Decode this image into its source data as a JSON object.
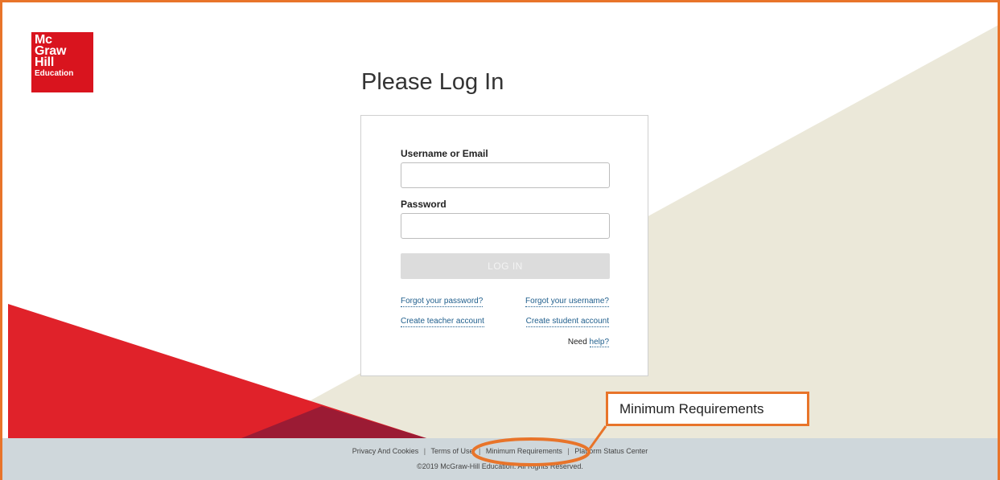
{
  "logo": {
    "line1": "Mc",
    "line2": "Graw",
    "line3": "Hill",
    "line4": "Education"
  },
  "page": {
    "title": "Please Log In"
  },
  "form": {
    "username_label": "Username or Email",
    "username_value": "",
    "password_label": "Password",
    "password_value": "",
    "login_label": "LOG IN",
    "forgot_password": "Forgot your password?",
    "forgot_username": "Forgot your username?",
    "create_teacher": "Create teacher account",
    "create_student": "Create student account",
    "need_text": "Need",
    "help_link": "help?"
  },
  "footer": {
    "links": [
      "Privacy And Cookies",
      "Terms of Use",
      "Minimum Requirements",
      "Platform Status Center"
    ],
    "separator": "|",
    "copyright": "©2019 McGraw-Hill Education. All Rights Reserved."
  },
  "callout": {
    "label": "Minimum Requirements"
  },
  "colors": {
    "accent_orange": "#e8742a",
    "brand_red": "#d9141e",
    "link_blue": "#1f5e8c",
    "footer_bg": "#cfd7db",
    "beige": "#ebe8d9"
  }
}
